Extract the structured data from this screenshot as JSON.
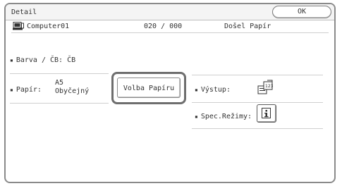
{
  "header": {
    "title": "Detail",
    "ok_label": "OK"
  },
  "job": {
    "source_icon": "computer-icon",
    "source_name": "Computer01",
    "count": "020 / 000",
    "status": "Došel Papír"
  },
  "settings": {
    "color_mode": "Barva / ČB: ČB",
    "paper_label": "Papír:",
    "paper_size": "A5",
    "paper_type": "Obyčejný",
    "paper_button_label": "Volba Papíru",
    "output_label": "Výstup:",
    "output_icon": "output-tray-icon",
    "special_label": "Spec.Režimy:",
    "special_icon": "info-icon"
  }
}
